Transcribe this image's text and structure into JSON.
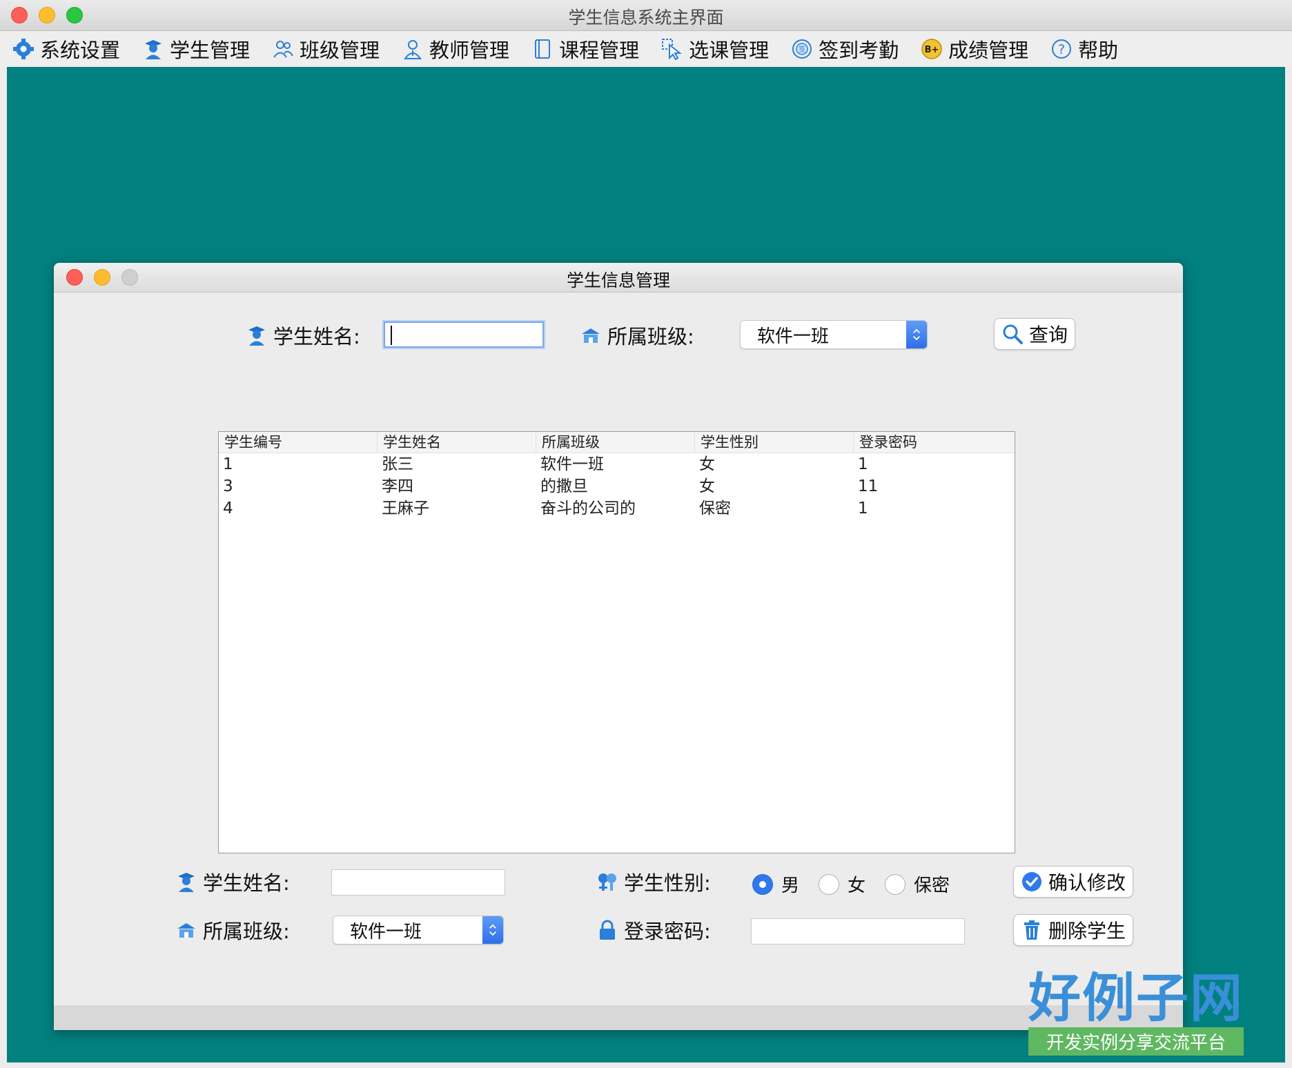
{
  "window": {
    "title": "学生信息系统主界面"
  },
  "menu": [
    {
      "label": "系统设置",
      "icon": "gear-icon"
    },
    {
      "label": "学生管理",
      "icon": "student-icon"
    },
    {
      "label": "班级管理",
      "icon": "class-icon"
    },
    {
      "label": "教师管理",
      "icon": "teacher-icon"
    },
    {
      "label": "课程管理",
      "icon": "book-icon"
    },
    {
      "label": "选课管理",
      "icon": "cursor-select-icon"
    },
    {
      "label": "签到考勤",
      "icon": "sign-in-icon"
    },
    {
      "label": "成绩管理",
      "icon": "grade-icon"
    },
    {
      "label": "帮助",
      "icon": "help-icon"
    }
  ],
  "dialog": {
    "title": "学生信息管理",
    "search": {
      "name_label": "学生姓名:",
      "name_value": "",
      "class_label": "所属班级:",
      "class_selected": "软件一班",
      "query_button": "查询"
    },
    "table": {
      "columns": [
        "学生编号",
        "学生姓名",
        "所属班级",
        "学生性别",
        "登录密码"
      ],
      "rows": [
        [
          "1",
          "张三",
          "软件一班",
          "女",
          "1"
        ],
        [
          "3",
          "李四",
          "的撒旦",
          "女",
          "11"
        ],
        [
          "4",
          "王麻子",
          "奋斗的公司的",
          "保密",
          "1"
        ]
      ]
    },
    "edit": {
      "name_label": "学生姓名:",
      "name_value": "",
      "gender_label": "学生性别:",
      "gender_options": [
        "男",
        "女",
        "保密"
      ],
      "gender_selected": "男",
      "class_label": "所属班级:",
      "class_selected": "软件一班",
      "password_label": "登录密码:",
      "password_value": "",
      "confirm_button": "确认修改",
      "delete_button": "删除学生"
    }
  },
  "watermark": {
    "title": "好例子网",
    "subtitle": "开发实例分享交流平台"
  },
  "colors": {
    "desktop": "#00807f",
    "accent": "#2f78ee"
  }
}
